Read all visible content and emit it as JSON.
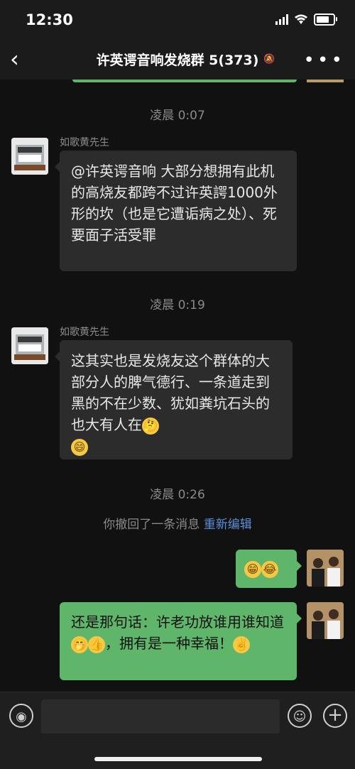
{
  "status_bar": {
    "time": "12:30",
    "battery_level": 0.65
  },
  "nav": {
    "title": "许英谔音响发烧群 5(373)",
    "back_icon": "chevron-left-icon",
    "mute_icon": "bell-slash-icon",
    "more_icon": "ellipsis-icon"
  },
  "chat": {
    "timestamps": [
      "凌晨 0:07",
      "凌晨 0:19",
      "凌晨 0:26"
    ],
    "messages": [
      {
        "sender": "如歌黄先生",
        "text": "@许英谔音响 大部分想拥有此机的高烧友都跨不过许英諤1000外形的坎（也是它遭诟病之处）、死要面子活受罪"
      },
      {
        "sender": "如歌黄先生",
        "text": "这其实也是发烧友这个群体的大部分人的脾气德行、一条道走到黑的不在少数、犹如粪坑石头的也大有人在",
        "emoji": [
          "🤔",
          "😄"
        ]
      },
      {
        "text": "还是那句话：许老功放谁用谁知道",
        "emoji_inline": [
          "🤭",
          "👍"
        ],
        "text_after": "，拥有是一种幸福！",
        "emoji_end": "✌️"
      }
    ],
    "recall": {
      "text": "你撤回了一条消息",
      "edit": "重新编辑"
    },
    "emoji_message": [
      "😁",
      "😂"
    ]
  },
  "input_bar": {
    "voice_icon": "voice-icon",
    "emoji_icon": "smile-icon",
    "plus_icon": "plus-icon"
  }
}
